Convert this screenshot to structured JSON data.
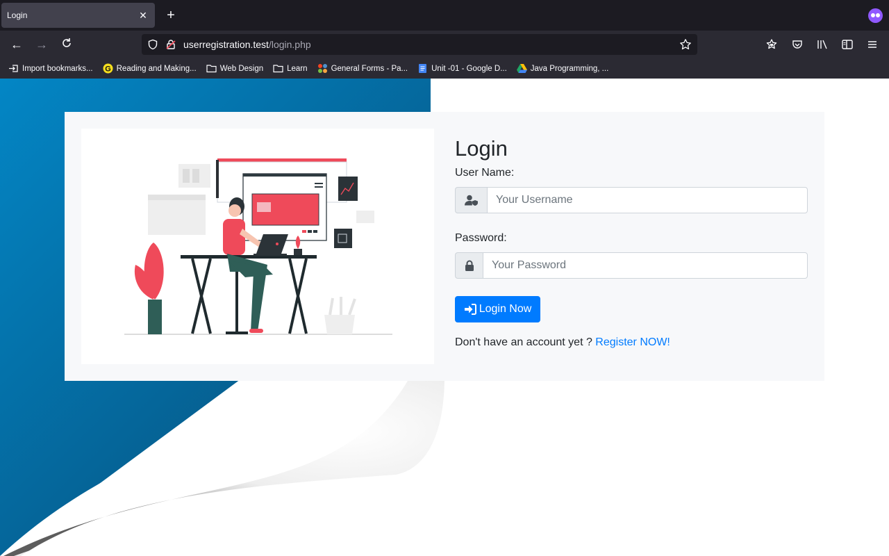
{
  "browser": {
    "tab_title": "Login",
    "url_host": "userregistration.test",
    "url_path": "/login.php",
    "bookmarks": [
      {
        "label": "Import bookmarks...",
        "icon": "import-icon"
      },
      {
        "label": "Reading and Making...",
        "icon": "g-logo-icon"
      },
      {
        "label": "Web Design",
        "icon": "folder-icon"
      },
      {
        "label": "Learn",
        "icon": "folder-icon"
      },
      {
        "label": "General Forms - Pa...",
        "icon": "joomla-icon"
      },
      {
        "label": "Unit -01 - Google D...",
        "icon": "google-docs-icon"
      },
      {
        "label": "Java Programming, ...",
        "icon": "google-drive-icon"
      }
    ]
  },
  "login": {
    "title": "Login",
    "username_label": "User Name:",
    "username_placeholder": "Your Username",
    "password_label": "Password:",
    "password_placeholder": "Your Password",
    "button_label": "Login Now",
    "register_prompt": "Don't have an account yet ? ",
    "register_link": "Register NOW!"
  },
  "colors": {
    "primary": "#007bff",
    "accent": "#ef4a5a",
    "bg_blue": "#0a6a9a"
  }
}
